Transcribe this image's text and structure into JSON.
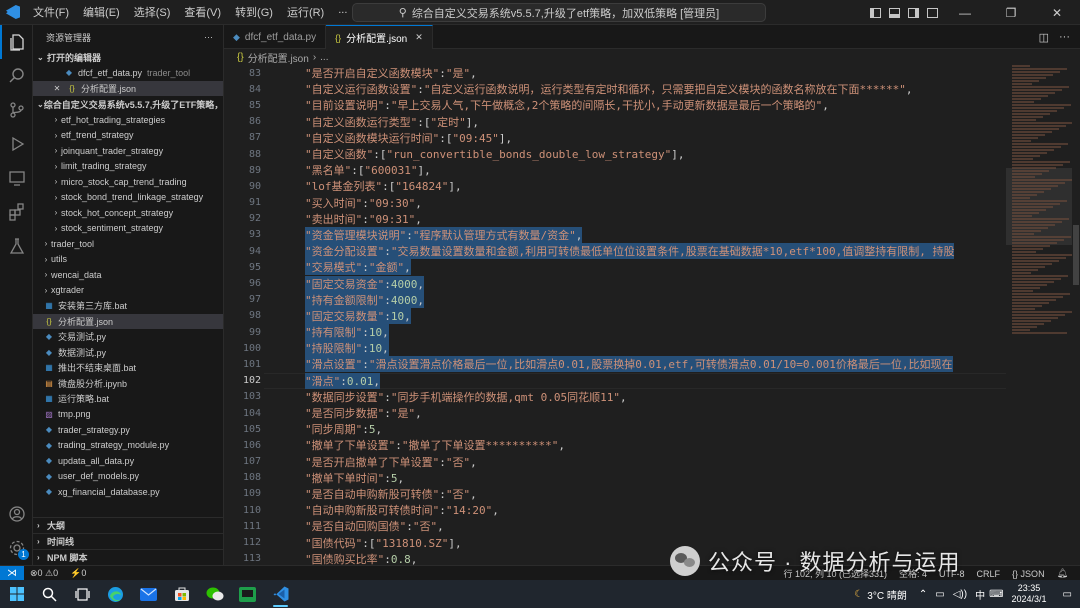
{
  "titlebar": {
    "menu": [
      "文件(F)",
      "编辑(E)",
      "选择(S)",
      "查看(V)",
      "转到(G)",
      "运行(R)",
      "..."
    ],
    "command_center": "综合自定义交易系统v5.5.7,升级了etf策略，加双低策略 [管理员]"
  },
  "sidebar": {
    "header": "资源管理器",
    "open_editors_title": "打开的编辑器",
    "open_editors": [
      {
        "name": "dfcf_etf_data.py",
        "desc": "trader_tool"
      },
      {
        "name": "分析配置.json",
        "desc": ""
      }
    ],
    "project_title": "综合自定义交易系统v5.5.7,升级了ETF策略，加...",
    "tree": [
      {
        "name": "etf_hot_trading_strategies",
        "type": "folder"
      },
      {
        "name": "etf_trend_strategy",
        "type": "folder"
      },
      {
        "name": "joinquant_trader_strategy",
        "type": "folder"
      },
      {
        "name": "limit_trading_strategy",
        "type": "folder"
      },
      {
        "name": "micro_stock_cap_trend_trading",
        "type": "folder"
      },
      {
        "name": "stock_bond_trend_linkage_strategy",
        "type": "folder"
      },
      {
        "name": "stock_hot_concept_strategy",
        "type": "folder"
      },
      {
        "name": "stock_sentiment_strategy",
        "type": "folder"
      },
      {
        "name": "trader_tool",
        "type": "folder-root"
      },
      {
        "name": "utils",
        "type": "folder-root"
      },
      {
        "name": "wencai_data",
        "type": "folder-root"
      },
      {
        "name": "xgtrader",
        "type": "folder-root"
      },
      {
        "name": "安装第三方库.bat",
        "type": "bat"
      },
      {
        "name": "分析配置.json",
        "type": "json"
      },
      {
        "name": "交易测试.py",
        "type": "py"
      },
      {
        "name": "数据测试.py",
        "type": "py"
      },
      {
        "name": "推出不结束桌面.bat",
        "type": "bat"
      },
      {
        "name": "微盘股分析.ipynb",
        "type": "nb"
      },
      {
        "name": "运行策略.bat",
        "type": "bat"
      },
      {
        "name": "tmp.png",
        "type": "png"
      },
      {
        "name": "trader_strategy.py",
        "type": "py"
      },
      {
        "name": "trading_strategy_module.py",
        "type": "py"
      },
      {
        "name": "updata_all_data.py",
        "type": "py"
      },
      {
        "name": "user_def_models.py",
        "type": "py"
      },
      {
        "name": "xg_financial_database.py",
        "type": "py"
      }
    ],
    "bottom_sections": [
      "大纲",
      "时间线",
      "NPM 脚本"
    ]
  },
  "tabs": [
    {
      "label": "dfcf_etf_data.py",
      "active": false
    },
    {
      "label": "分析配置.json",
      "active": true
    }
  ],
  "breadcrumb": {
    "file": "分析配置.json",
    "rest": "..."
  },
  "code_lines": [
    {
      "n": "83",
      "text": "\"是否开启自定义函数模块\":\"是\",",
      "hl": false
    },
    {
      "n": "84",
      "text": "\"自定义运行函数设置\":\"自定义运行函数说明，运行类型有定时和循环，只需要把自定义模块的函数名称放在下面******\",",
      "hl": false
    },
    {
      "n": "85",
      "text": "\"目前设置说明\":\"早上交易人气,下午做概念,2个策略的间隔长,干扰小,手动更新数据是最后一个策略的\",",
      "hl": false
    },
    {
      "n": "86",
      "text": "\"自定义函数运行类型\":[\"定时\"],",
      "hl": false
    },
    {
      "n": "87",
      "text": "\"自定义函数模块运行时间\":[\"09:45\"],",
      "hl": false
    },
    {
      "n": "88",
      "text": "\"自定义函数\":[\"run_convertible_bonds_double_low_strategy\"],",
      "hl": false
    },
    {
      "n": "89",
      "text": "\"黑名单\":[\"600031\"],",
      "hl": false
    },
    {
      "n": "90",
      "text": "\"lof基金列表\":[\"164824\"],",
      "hl": false
    },
    {
      "n": "91",
      "text": "\"买入时间\":\"09:30\",",
      "hl": false
    },
    {
      "n": "92",
      "text": "\"卖出时间\":\"09:31\",",
      "hl": false
    },
    {
      "n": "93",
      "text": "\"资金管理模块说明\":\"程序默认管理方式有数量/资金\",",
      "hl": true
    },
    {
      "n": "94",
      "text": "\"资金分配设置\":\"交易数量设置数量和金额,利用可转债最低单位位设置条件,股票在基础数据*10,etf*100,值调整持有限制, 持股",
      "hl": true
    },
    {
      "n": "95",
      "text": "\"交易模式\":\"金额\",",
      "hl": true
    },
    {
      "n": "96",
      "text": "\"固定交易资金\":4000,",
      "hl": true
    },
    {
      "n": "97",
      "text": "\"持有金额限制\":4000,",
      "hl": true
    },
    {
      "n": "98",
      "text": "\"固定交易数量\":10,",
      "hl": true
    },
    {
      "n": "99",
      "text": "\"持有限制\":10,",
      "hl": true
    },
    {
      "n": "100",
      "text": "\"持股限制\":10,",
      "hl": true
    },
    {
      "n": "101",
      "text": "\"滑点设置\":\"滑点设置滑点价格最后一位,比如滑点0.01,股票换掉0.01,etf,可转债滑点0.01/10=0.001价格最后一位,比如现在",
      "hl": true
    },
    {
      "n": "102",
      "text": "\"滑点\":0.01,",
      "hl": true
    },
    {
      "n": "103",
      "text": "\"数据同步设置\":\"同步手机端操作的数据,qmt 0.05同花顺11\",",
      "hl": false
    },
    {
      "n": "104",
      "text": "\"是否同步数据\":\"是\",",
      "hl": false
    },
    {
      "n": "105",
      "text": "\"同步周期\":5,",
      "hl": false
    },
    {
      "n": "106",
      "text": "\"撤单了下单设置\":\"撤单了下单设置**********\",",
      "hl": false
    },
    {
      "n": "107",
      "text": "\"是否开启撤单了下单设置\":\"否\",",
      "hl": false
    },
    {
      "n": "108",
      "text": "\"撤单下单时间\":5,",
      "hl": false
    },
    {
      "n": "109",
      "text": "\"是否自动申购新股可转债\":\"否\",",
      "hl": false
    },
    {
      "n": "110",
      "text": "\"自动申购新股可转债时间\":\"14:20\",",
      "hl": false
    },
    {
      "n": "111",
      "text": "\"是否自动回购国债\":\"否\",",
      "hl": false
    },
    {
      "n": "112",
      "text": "\"国债代码\":[\"131810.SZ\"],",
      "hl": false
    },
    {
      "n": "113",
      "text": "\"国债购买比率\":0.8,",
      "hl": false
    }
  ],
  "current_line": "102",
  "statusbar": {
    "problems": "⊗0 ⚠0",
    "ports": "⚡0",
    "position": "行 102, 列 10 (已选择331)",
    "spaces": "空格: 4",
    "encoding": "UTF-8",
    "eol": "CRLF",
    "language": "{} JSON"
  },
  "taskbar": {
    "weather": "3°C 晴朗",
    "ime": "中",
    "time": "23:35",
    "date": "2024/3/1"
  },
  "watermark": "公众号 · 数据分析与运用"
}
